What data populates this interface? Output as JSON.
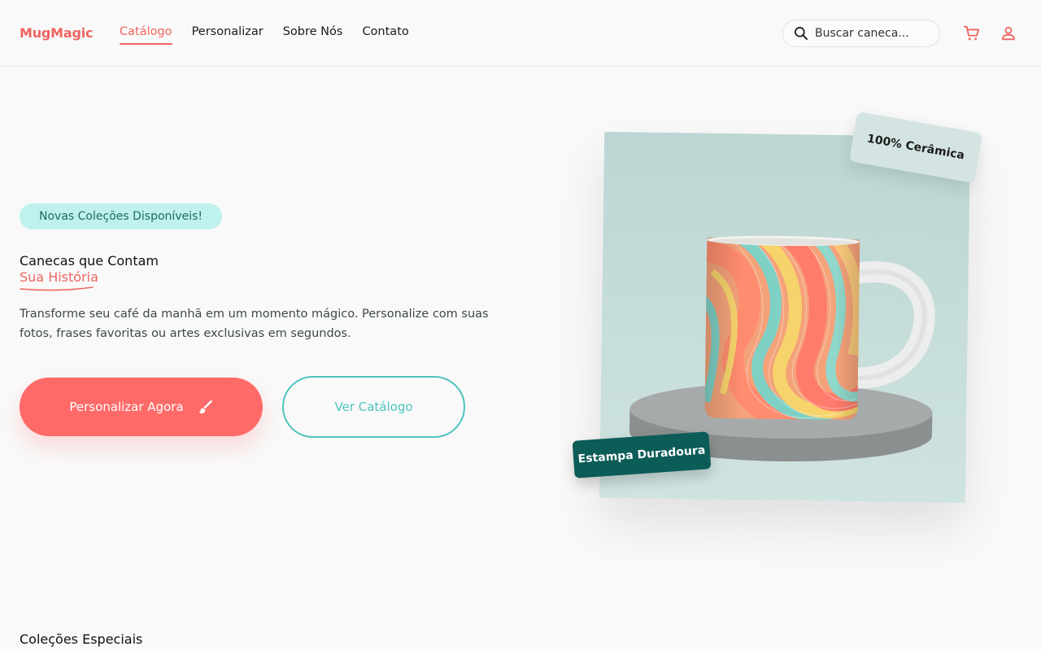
{
  "brand": {
    "name": "MugMagic",
    "accent": "#ef6461",
    "teal": "#4ec3bd"
  },
  "nav": {
    "items": [
      {
        "label": "Catálogo",
        "active": true
      },
      {
        "label": "Personalizar",
        "active": false
      },
      {
        "label": "Sobre Nós",
        "active": false
      },
      {
        "label": "Contato",
        "active": false
      }
    ]
  },
  "search": {
    "placeholder": "Buscar caneca...",
    "icon": "search-icon"
  },
  "header_icons": {
    "cart": "cart-icon",
    "user": "user-icon"
  },
  "hero": {
    "badge": "Novas Coleções Disponíveis!",
    "title_line1": "Canecas que Contam",
    "title_line2": "Sua História",
    "lead": "Transforme seu café da manhã em um momento mágico. Personalize com suas fotos, frases favoritas ou artes exclusivas em segundos.",
    "primary_button": "Personalizar Agora",
    "primary_button_icon": "brush-icon",
    "secondary_button": "Ver Catálogo",
    "tag_top": "100% Cerâmica",
    "tag_bottom": "Estampa Duradoura"
  },
  "section": {
    "title": "Coleções Especiais"
  }
}
